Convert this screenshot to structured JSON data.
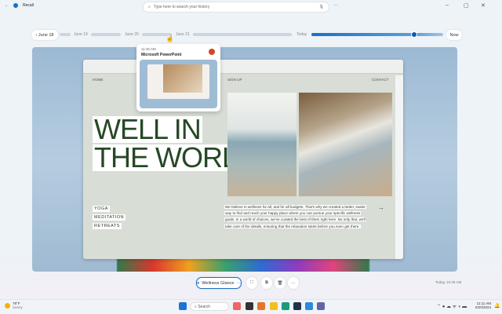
{
  "app": {
    "title": "Recall",
    "back": "←"
  },
  "search": {
    "placeholder": "Type here to search your history"
  },
  "window": {
    "minimize": "–",
    "maximize": "▢",
    "close": "✕",
    "more": "···"
  },
  "timeline": {
    "back_label": "June 18",
    "labels": [
      "June 19",
      "June 20",
      "June 21",
      "Today"
    ],
    "now_label": "Now",
    "position": 0.83
  },
  "popup": {
    "time": "11:45 AM",
    "app": "Microsoft PowerPoint"
  },
  "website": {
    "nav": [
      "HOME",
      "SIGN UP",
      "CONTACT"
    ],
    "headline": [
      "WELL IN",
      "THE WORLD"
    ],
    "menu": [
      "YOGA",
      "MEDITATION",
      "RETREATS"
    ],
    "paragraph": [
      "We believe in wellness for all, and for all budgets. That's why we created a better, easier",
      "way to find and reach your happy place where you can pursue your specific wellness",
      "goals. In a world of choices, we've curated the best of them right here. No only that, we'll",
      "take care of the details, ensuring that the relaxation starts before you even get there."
    ],
    "arrow": "→"
  },
  "toolbar": {
    "context_label": "Wellness Glance",
    "more": "···",
    "timestamp": "Today, 10:30 AM"
  },
  "taskbar": {
    "weather_temp": "78°F",
    "weather_desc": "Sunny",
    "search": "Search",
    "time": "11:11 AM",
    "date": "6/20/2024"
  },
  "colors": {
    "accent": "#1a6fc4",
    "headline": "#264826"
  }
}
